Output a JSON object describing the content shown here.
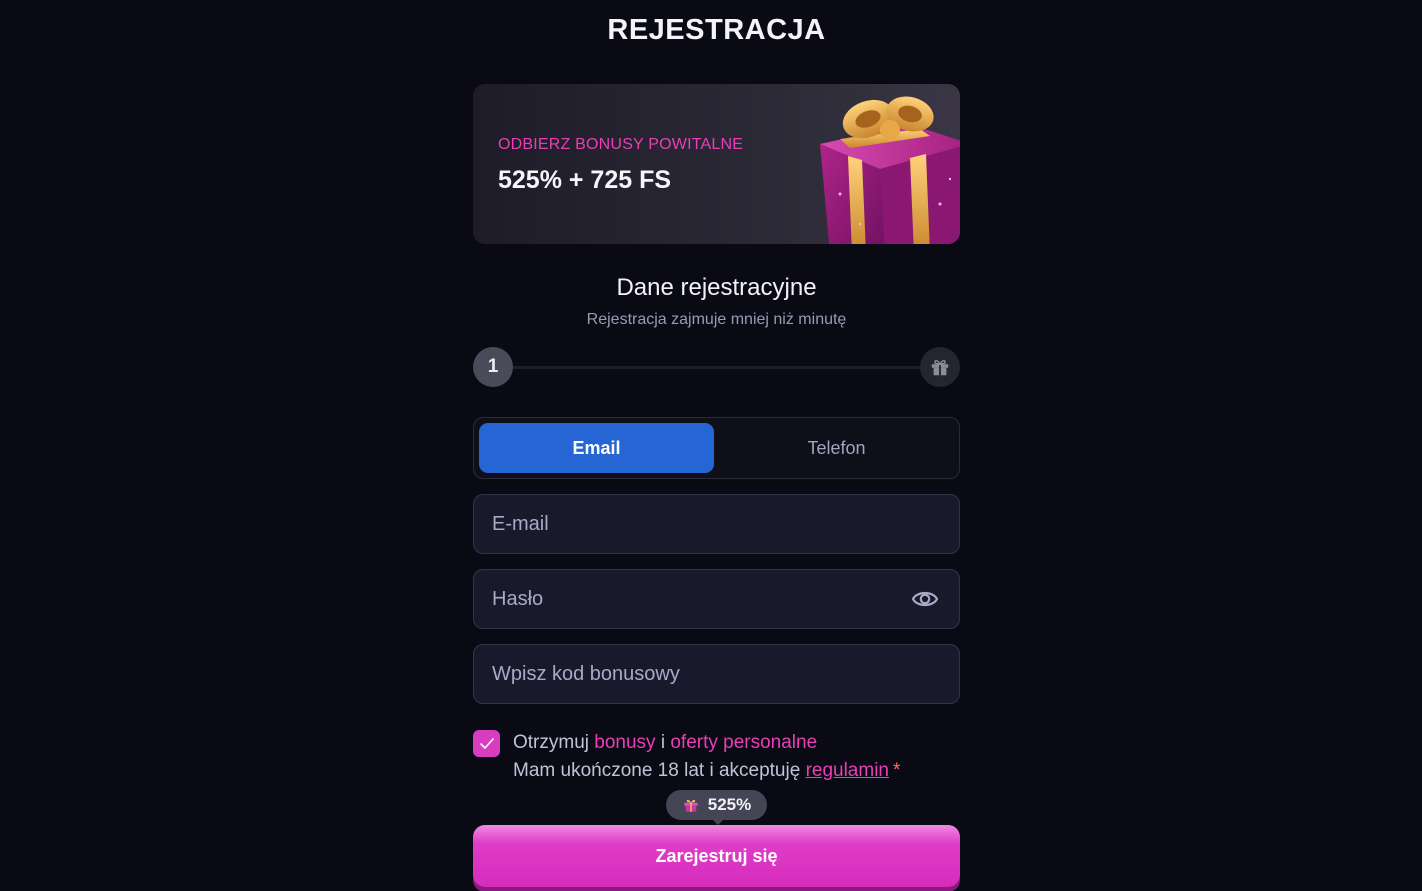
{
  "page": {
    "title": "REJESTRACJA"
  },
  "banner": {
    "eyebrow": "ODBIERZ BONUSY POWITALNE",
    "value": "525% + 725 FS"
  },
  "form_header": {
    "title": "Dane rejestracyjne",
    "subtitle": "Rejestracja zajmuje mniej niż minutę"
  },
  "stepper": {
    "current_step": "1"
  },
  "tabs": [
    {
      "label": "Email",
      "active": true
    },
    {
      "label": "Telefon",
      "active": false
    }
  ],
  "fields": {
    "email": {
      "placeholder": "E-mail",
      "value": ""
    },
    "password": {
      "placeholder": "Hasło",
      "value": ""
    },
    "bonus_code": {
      "placeholder": "Wpisz kod bonusowy",
      "value": ""
    }
  },
  "consent": {
    "checked": true,
    "line1_prefix": "Otrzymuj ",
    "line1_link1": "bonusy",
    "line1_mid": " i ",
    "line1_link2": "oferty personalne",
    "line2_prefix": "Mam ukończone 18 lat i akceptuję ",
    "line2_link": "regulamin",
    "required_mark": "*"
  },
  "bonus_badge": {
    "value": "525%"
  },
  "submit": {
    "label": "Zarejestruj się"
  },
  "colors": {
    "background": "#0a0a14",
    "accent_pink": "#e93fb6",
    "tab_active": "#2565d4",
    "button": "#d62cbd"
  },
  "icons": {
    "gift": "gift-icon",
    "eye": "eye-icon",
    "check": "check-icon"
  }
}
